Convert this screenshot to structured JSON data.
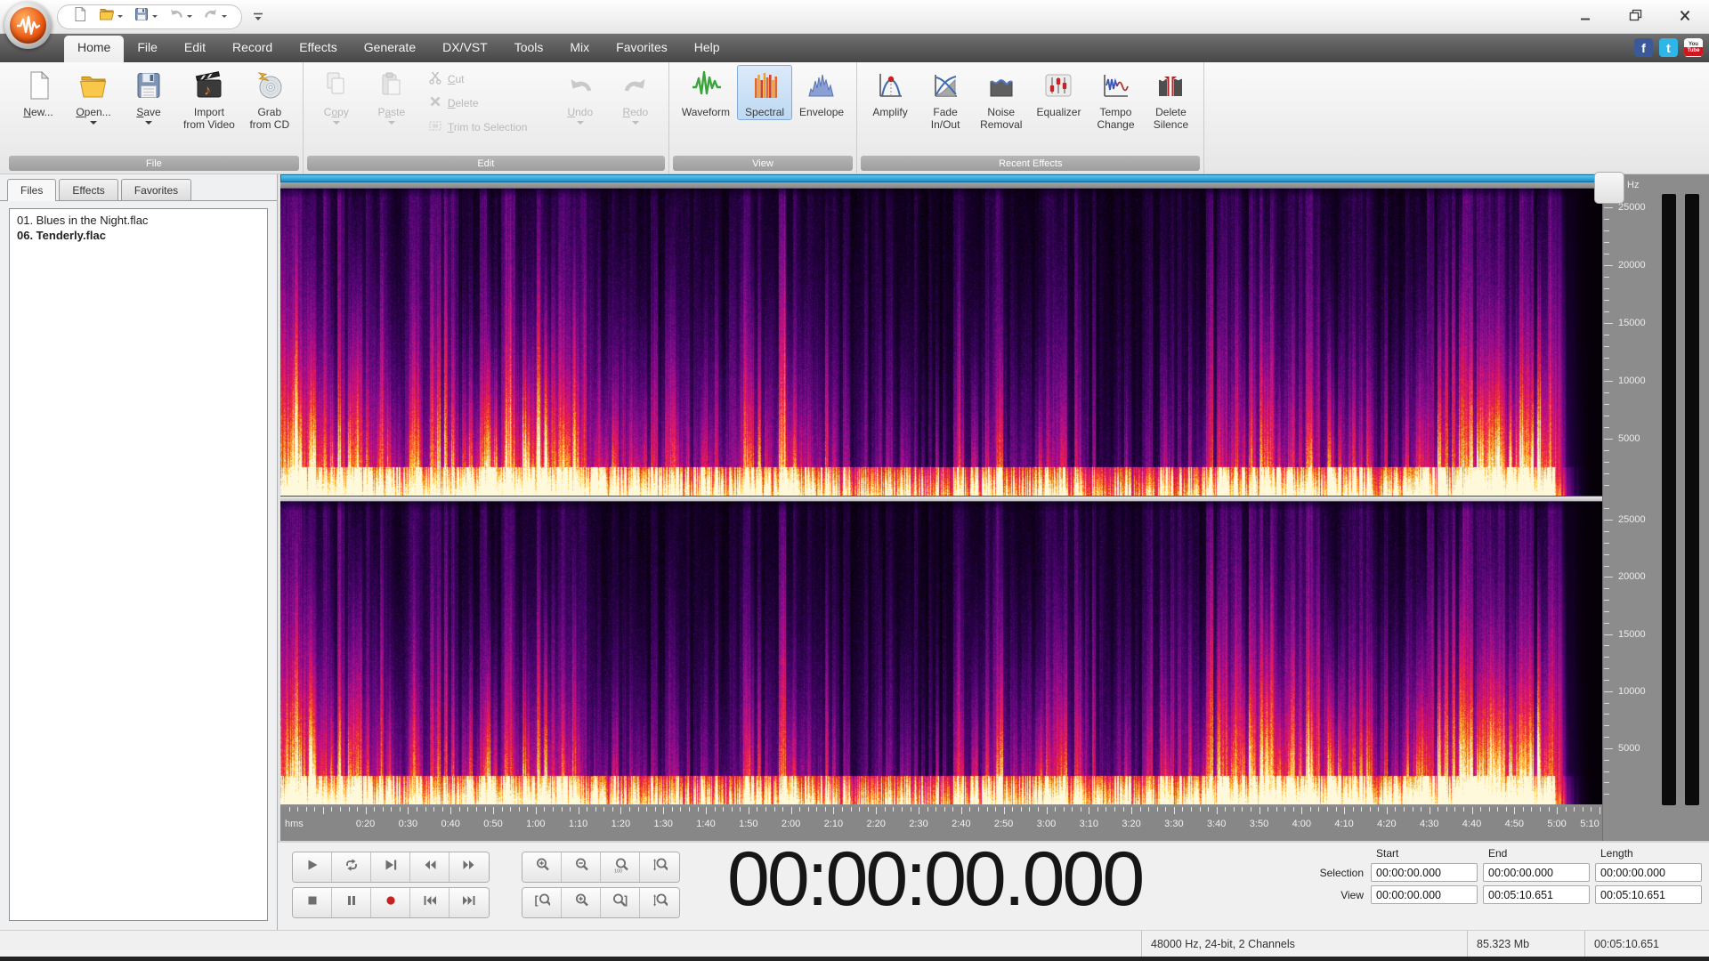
{
  "quick_access": {
    "buttons": [
      {
        "name": "new",
        "icon": "qat-doc"
      },
      {
        "name": "open",
        "icon": "qat-folder",
        "dropdown": true
      },
      {
        "name": "save",
        "icon": "qat-floppy",
        "dropdown": true
      },
      {
        "name": "undo",
        "icon": "qat-undo",
        "dropdown": true,
        "disabled": true
      },
      {
        "name": "redo",
        "icon": "qat-redo",
        "dropdown": true,
        "disabled": true
      }
    ]
  },
  "tabs": {
    "items": [
      "Home",
      "File",
      "Edit",
      "Record",
      "Effects",
      "Generate",
      "DX/VST",
      "Tools",
      "Mix",
      "Favorites",
      "Help"
    ],
    "active": "Home"
  },
  "social": [
    {
      "name": "facebook",
      "label": "f",
      "color": "#3b5998"
    },
    {
      "name": "twitter",
      "label": "t",
      "color": "#2fb6e8"
    },
    {
      "name": "youtube",
      "label_top": "You",
      "label_bottom": "Tube",
      "color": "#cc181e"
    }
  ],
  "ribbon": {
    "groups": [
      {
        "label": "File",
        "items": [
          {
            "label": "New...",
            "accel": 0,
            "icon": "new-file"
          },
          {
            "label": "Open...",
            "accel": 0,
            "icon": "open-folder",
            "dropdown": true
          },
          {
            "label": "Save",
            "accel": 0,
            "icon": "save",
            "dropdown": true
          },
          {
            "label": "Import|from Video",
            "icon": "import-video"
          },
          {
            "label": "Grab|from CD",
            "icon": "grab-cd"
          }
        ]
      },
      {
        "label": "Edit",
        "items": [
          {
            "label": "Copy",
            "accel": 1,
            "icon": "copy",
            "dropdown": true,
            "disabled": true
          },
          {
            "label": "Paste",
            "accel": 1,
            "icon": "paste",
            "dropdown": true,
            "disabled": true
          },
          {
            "stack": [
              {
                "label": "Cut",
                "accel": 0,
                "icon": "cut",
                "disabled": true
              },
              {
                "label": "Delete",
                "accel": 0,
                "icon": "delete",
                "disabled": true
              },
              {
                "label": "Trim to Selection",
                "accel": 0,
                "icon": "trim",
                "disabled": true
              }
            ]
          },
          {
            "label": "Undo",
            "accel": 0,
            "icon": "undo",
            "dropdown": true,
            "disabled": true
          },
          {
            "label": "Redo",
            "accel": 0,
            "icon": "redo",
            "dropdown": true,
            "disabled": true
          }
        ]
      },
      {
        "label": "View",
        "items": [
          {
            "label": "Waveform",
            "icon": "waveform"
          },
          {
            "label": "Spectral",
            "icon": "spectral",
            "selected": true
          },
          {
            "label": "Envelope",
            "icon": "envelope"
          }
        ]
      },
      {
        "label": "Recent Effects",
        "items": [
          {
            "label": "Amplify",
            "icon": "amplify"
          },
          {
            "label": "Fade|In/Out",
            "icon": "fade"
          },
          {
            "label": "Noise|Removal",
            "icon": "noise"
          },
          {
            "label": "Equalizer",
            "icon": "equalizer"
          },
          {
            "label": "Tempo|Change",
            "icon": "tempo"
          },
          {
            "label": "Delete|Silence",
            "icon": "delete-silence"
          }
        ]
      }
    ]
  },
  "sidebar": {
    "tabs": [
      "Files",
      "Effects",
      "Favorites"
    ],
    "active": "Files",
    "files": [
      {
        "name": "01. Blues in the Night.flac",
        "current": false
      },
      {
        "name": "06. Tenderly.flac",
        "current": true
      }
    ]
  },
  "editor": {
    "freq_unit": "Hz",
    "freq_labels": [
      25000,
      20000,
      15000,
      10000,
      5000
    ],
    "freq_max": 26500,
    "ruler_unit": "hms",
    "duration_seconds": 310.651,
    "time_labels": [
      "0:20",
      "0:30",
      "0:40",
      "0:50",
      "1:00",
      "1:10",
      "1:20",
      "1:30",
      "1:40",
      "1:50",
      "2:00",
      "2:10",
      "2:20",
      "2:30",
      "2:40",
      "2:50",
      "3:00",
      "3:10",
      "3:20",
      "3:30",
      "3:40",
      "3:50",
      "4:00",
      "4:10",
      "4:20",
      "4:30",
      "4:40",
      "4:50",
      "5:00",
      "5:10"
    ],
    "palette": [
      [
        0,
        "#060009"
      ],
      [
        0.16,
        "#1e0138"
      ],
      [
        0.33,
        "#4c0570"
      ],
      [
        0.5,
        "#8e0d8e"
      ],
      [
        0.63,
        "#d01178"
      ],
      [
        0.75,
        "#ef2a3a"
      ],
      [
        0.85,
        "#ff8420"
      ],
      [
        0.93,
        "#ffce44"
      ],
      [
        1,
        "#fff9dc"
      ]
    ]
  },
  "transport": {
    "rows": [
      {
        "main": [
          "play",
          "loop",
          "play-to-end",
          "rewind",
          "fast-forward"
        ],
        "zoom": [
          "zoom-in",
          "zoom-out",
          "zoom-100",
          "zoom-vertical"
        ]
      },
      {
        "main": [
          "stop",
          "pause",
          "record",
          "go-to-start",
          "go-to-end"
        ],
        "zoom": [
          "zoom-selection-start",
          "zoom-selection",
          "zoom-selection-end",
          "zoom-vertical-fit"
        ]
      }
    ]
  },
  "time_display": "00:00:00.000",
  "fields": {
    "headers": [
      "Start",
      "End",
      "Length"
    ],
    "rows": [
      {
        "label": "Selection",
        "values": [
          "00:00:00.000",
          "00:00:00.000",
          "00:00:00.000"
        ]
      },
      {
        "label": "View",
        "values": [
          "00:00:00.000",
          "00:05:10.651",
          "00:05:10.651"
        ]
      }
    ]
  },
  "status": {
    "format": "48000 Hz, 24-bit, 2 Channels",
    "size": "85.323 Mb",
    "duration": "00:05:10.651"
  },
  "colors": {
    "scrollbar_blue_top": "#5ec8f0",
    "scrollbar_blue_bottom": "#1a8cc6",
    "record_red": "#c32323",
    "selection_highlight": "#cfe3f8",
    "meter_black": "#0b0b0b"
  }
}
